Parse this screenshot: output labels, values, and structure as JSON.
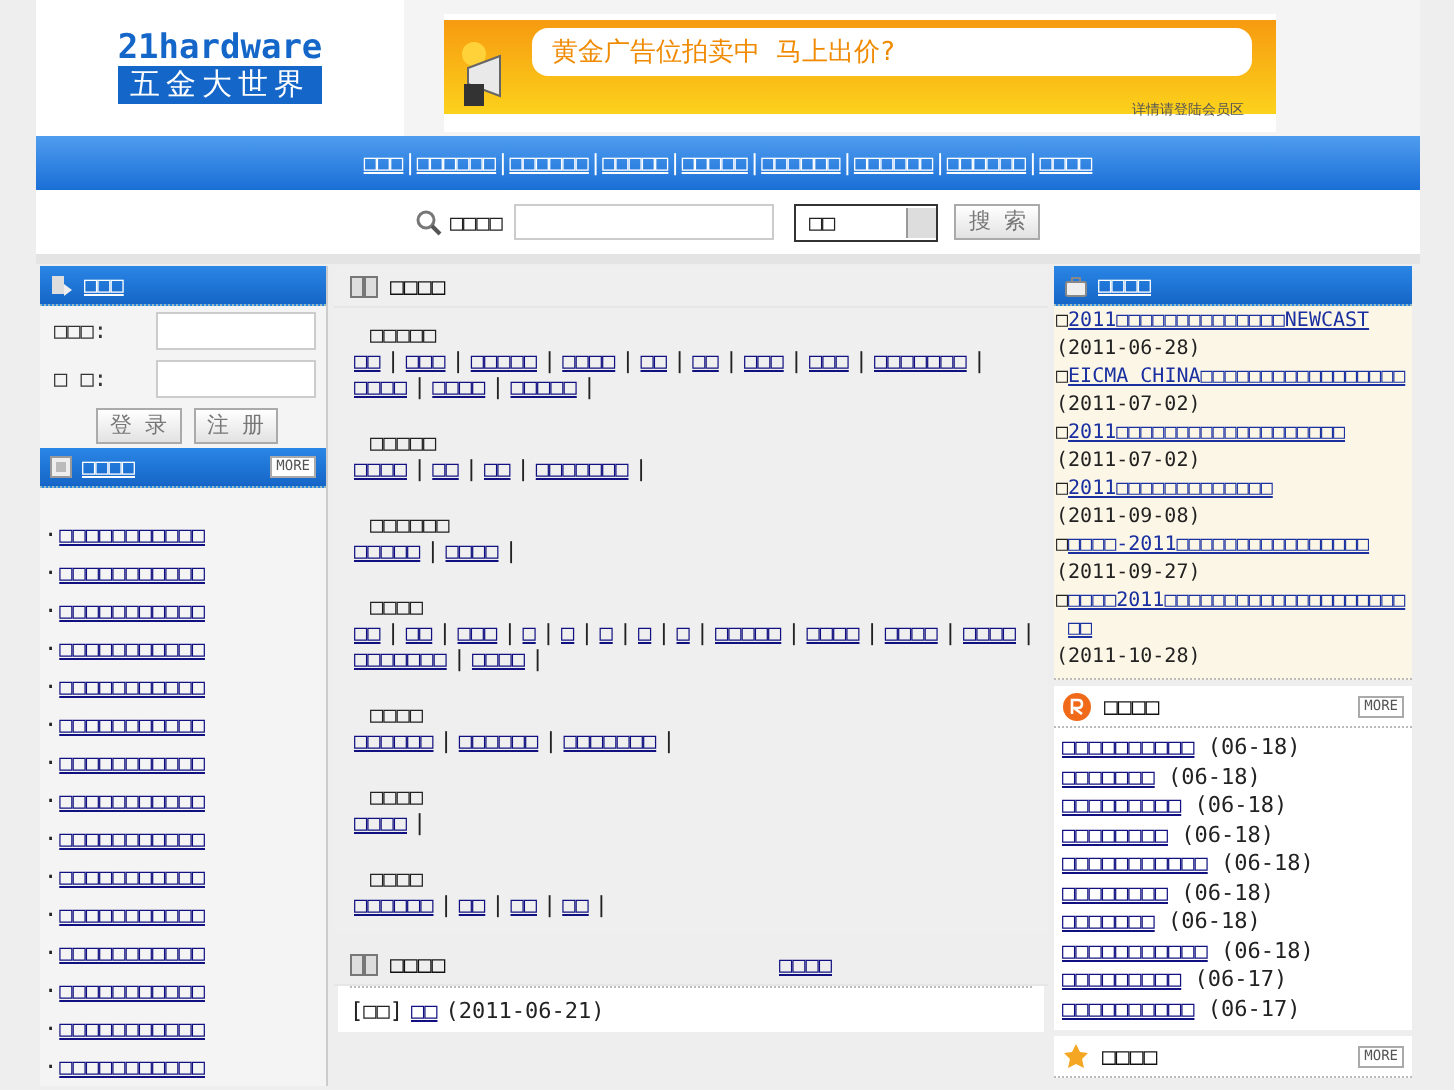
{
  "logo": {
    "latin": "21hardware",
    "chinese": "五金大世界"
  },
  "banner": {
    "headline": "黄金广告位拍卖中  马上出价?",
    "note": "详情请登陆会员区"
  },
  "nav": [
    {
      "text": "□□□",
      "sep": "|"
    },
    {
      "text": "□□□□□□",
      "sep": "|"
    },
    {
      "text": "□□□□□□",
      "sep": "|"
    },
    {
      "text": "□□□□□",
      "sep": "|"
    },
    {
      "text": "□□□□□",
      "sep": "|"
    },
    {
      "text": "□□□□□□",
      "sep": "|"
    },
    {
      "text": "□□□□□□",
      "sep": "|"
    },
    {
      "text": "□□□□□□",
      "sep": "|"
    },
    {
      "text": "□□□□"
    }
  ],
  "search": {
    "label": "□□□□",
    "category": "□□",
    "button": "搜 索"
  },
  "login": {
    "title": "□□□",
    "user_label": "□□□:",
    "password_label": "□ □:",
    "login_button": "登 录",
    "register_button": "注 册"
  },
  "left_list": {
    "title": "□□□□",
    "more": "MORE",
    "items": [
      {
        "bullet": "·",
        "text": "□□□□□□□□□□□"
      },
      {
        "bullet": "·",
        "text": "□□□□□□□□□□□"
      },
      {
        "bullet": "·",
        "text": "□□□□□□□□□□□"
      },
      {
        "bullet": "·",
        "text": "□□□□□□□□□□□"
      },
      {
        "bullet": "·",
        "text": "□□□□□□□□□□□"
      },
      {
        "bullet": "·",
        "text": "□□□□□□□□□□□"
      },
      {
        "bullet": "·",
        "text": "□□□□□□□□□□□"
      },
      {
        "bullet": "·",
        "text": "□□□□□□□□□□□"
      },
      {
        "bullet": "·",
        "text": "□□□□□□□□□□□"
      },
      {
        "bullet": "·",
        "text": "□□□□□□□□□□□"
      },
      {
        "bullet": "·",
        "text": "□□□□□□□□□□□"
      },
      {
        "bullet": "·",
        "text": "□□□□□□□□□□□"
      },
      {
        "bullet": "·",
        "text": "□□□□□□□□□□□"
      },
      {
        "bullet": "·",
        "text": "□□□□□□□□□□□"
      },
      {
        "bullet": "·",
        "text": "□□□□□□□□□□□"
      }
    ]
  },
  "directory": {
    "title": "□□□□",
    "sections": [
      {
        "title": "□□□□□",
        "links": [
          {
            "text": "□□",
            "sep": "|"
          },
          {
            "text": "□□□",
            "sep": "|"
          },
          {
            "text": "□□□□□",
            "sep": "|"
          },
          {
            "text": "□□□□",
            "sep": "|"
          },
          {
            "text": "□□",
            "sep": "|"
          },
          {
            "text": "□□",
            "sep": "|"
          },
          {
            "text": "□□□",
            "sep": "|"
          },
          {
            "text": "□□□",
            "sep": "|"
          },
          {
            "text": "□□□□□□□",
            "sep": "|"
          },
          {
            "text": "□□□□",
            "sep": "|"
          },
          {
            "text": "□□□□",
            "sep": "|"
          },
          {
            "text": "□□□□□",
            "sep": "|"
          }
        ]
      },
      {
        "title": "□□□□□",
        "links": [
          {
            "text": "□□□□",
            "sep": "|"
          },
          {
            "text": "□□",
            "sep": "|"
          },
          {
            "text": "□□",
            "sep": "|"
          },
          {
            "text": "□□□□□□□",
            "sep": "|"
          }
        ]
      },
      {
        "title": "□□□□□□",
        "links": [
          {
            "text": "□□□□□",
            "sep": "|"
          },
          {
            "text": "□□□□",
            "sep": "|"
          }
        ]
      },
      {
        "title": "□□□□",
        "links": [
          {
            "text": "□□",
            "sep": "|"
          },
          {
            "text": "□□",
            "sep": "|"
          },
          {
            "text": "□□□",
            "sep": "|"
          },
          {
            "text": "□",
            "sep": "|"
          },
          {
            "text": "□",
            "sep": "|"
          },
          {
            "text": "□",
            "sep": "|"
          },
          {
            "text": "□",
            "sep": "|"
          },
          {
            "text": "□",
            "sep": "|"
          },
          {
            "text": "□□□□□",
            "sep": "|"
          },
          {
            "text": "□□□□",
            "sep": "|"
          },
          {
            "text": "□□□□",
            "sep": "|"
          },
          {
            "text": "□□□□",
            "sep": "|"
          },
          {
            "text": "□□□□□□□",
            "sep": "|"
          },
          {
            "text": "□□□□",
            "sep": "|"
          }
        ]
      },
      {
        "title": "□□□□",
        "links": [
          {
            "text": "□□□□□□",
            "sep": "|"
          },
          {
            "text": "□□□□□□",
            "sep": "|"
          },
          {
            "text": "□□□□□□□",
            "sep": "|"
          }
        ]
      },
      {
        "title": "□□□□",
        "links": [
          {
            "text": "□□□□",
            "sep": "|"
          }
        ]
      },
      {
        "title": "□□□□",
        "links": [
          {
            "text": "□□□□□□",
            "sep": "|"
          },
          {
            "text": "□□",
            "sep": "|"
          },
          {
            "text": "□□",
            "sep": "|"
          },
          {
            "text": "□□",
            "sep": "|"
          }
        ]
      }
    ]
  },
  "latest": {
    "title": "□□□□",
    "more_link": "□□□□",
    "rows": [
      {
        "tag": "[□□]",
        "link": "□□",
        "date": "(2011-06-21)"
      }
    ]
  },
  "news": {
    "title": "□□□□",
    "items": [
      {
        "mark": "□",
        "link": "2011□□□□□□□□□□□□□□NEWCAST",
        "date": "(2011-06-28)"
      },
      {
        "mark": "□",
        "link": "EICMA CHINA□□□□□□□□□□□□□□□□□",
        "date": "(2011-07-02)"
      },
      {
        "mark": "□",
        "link": "2011□□□□□□□□□□□□□□□□□□□",
        "date": "(2011-07-02)"
      },
      {
        "mark": "□",
        "link": "2011□□□□□□□□□□□□□",
        "date": "(2011-09-08)"
      },
      {
        "mark": "□",
        "link": "□□□□-2011□□□□□□□□□□□□□□□□",
        "date": "(2011-09-27)"
      },
      {
        "mark": "□",
        "link": "□□□□2011□□□□□□□□□□□□□□□□□□□□□□",
        "date": "(2011-10-28)"
      }
    ]
  },
  "recent": {
    "title": "□□□□",
    "more": "MORE",
    "items": [
      {
        "link": "□□□□□□□□□□",
        "date": "(06-18)"
      },
      {
        "link": "□□□□□□□",
        "date": "(06-18)"
      },
      {
        "link": "□□□□□□□□□",
        "date": "(06-18)"
      },
      {
        "link": "□□□□□□□□",
        "date": "(06-18)"
      },
      {
        "link": "□□□□□□□□□□□",
        "date": "(06-18)"
      },
      {
        "link": "□□□□□□□□",
        "date": "(06-18)"
      },
      {
        "link": "□□□□□□□",
        "date": "(06-18)"
      },
      {
        "link": "□□□□□□□□□□□",
        "date": "(06-18)"
      },
      {
        "link": "□□□□□□□□□",
        "date": "(06-17)"
      },
      {
        "link": "□□□□□□□□□□",
        "date": "(06-17)"
      }
    ]
  },
  "third": {
    "title": "□□□□",
    "more": "MORE"
  }
}
